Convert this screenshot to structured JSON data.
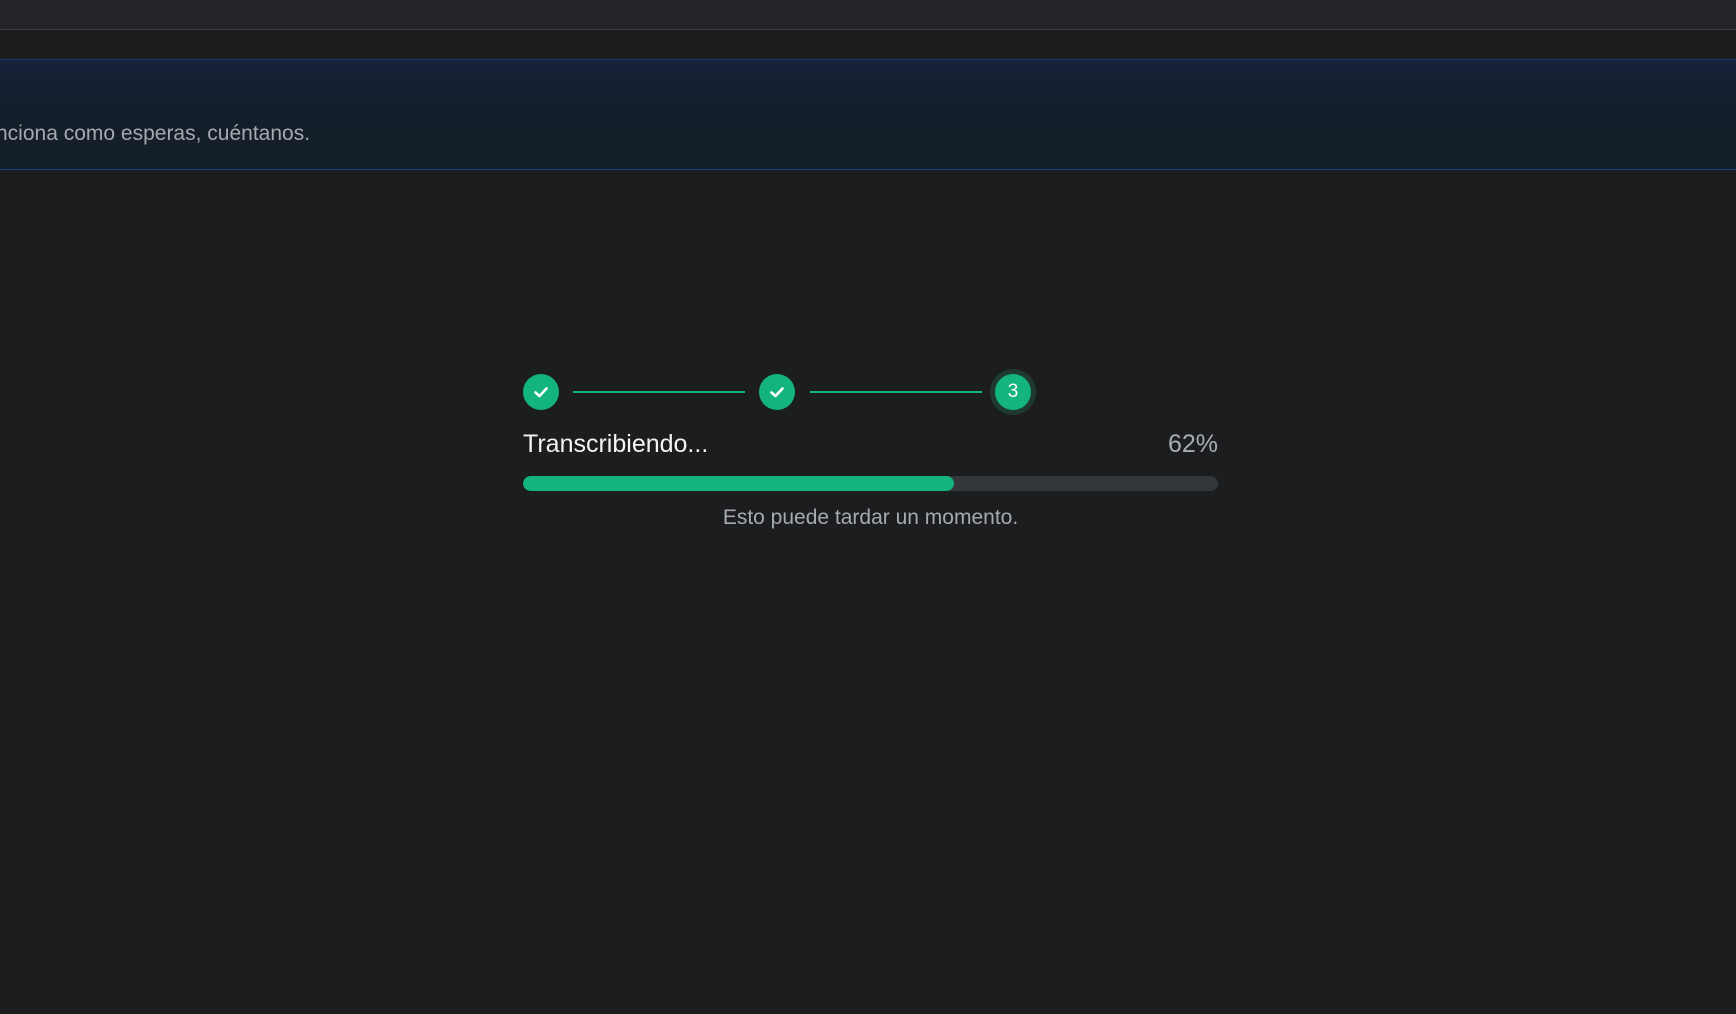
{
  "banner": {
    "text": "nciona como esperas, cuéntanos."
  },
  "stepper": {
    "steps": [
      {
        "state": "complete",
        "icon": "check-icon"
      },
      {
        "state": "complete",
        "icon": "check-icon"
      },
      {
        "state": "active",
        "label": "3"
      }
    ]
  },
  "progress": {
    "label": "Transcribiendo...",
    "percent_text": "62%",
    "value": 0.62,
    "hint": "Esto puede tardar un momento."
  },
  "colors": {
    "accent": "#13b47d",
    "track": "#33363a",
    "background": "#1c1d1f"
  }
}
